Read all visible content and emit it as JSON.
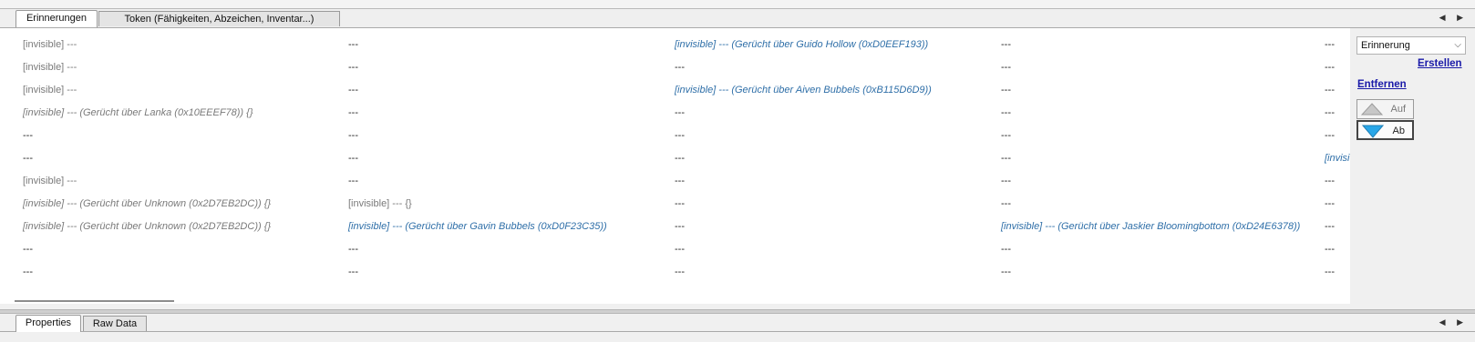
{
  "top_tabs": [
    {
      "label": "Erinnerungen",
      "active": true
    },
    {
      "label": "Token (Fähigkeiten, Abzeichen, Inventar...)",
      "active": false
    }
  ],
  "bottom_tabs": [
    {
      "label": "Properties",
      "active": true
    },
    {
      "label": "Raw Data",
      "active": false
    }
  ],
  "tab_nav_arrows": "◀ ▶",
  "rows": [
    [
      "[invisible] ---",
      "---",
      "[invisible] --- (Gerücht über Guido Hollow (0xD0EEF193))",
      "---",
      "---"
    ],
    [
      "[invisible] ---",
      "---",
      "---",
      "---",
      "---"
    ],
    [
      "[invisible] ---",
      "---",
      "[invisible] --- (Gerücht über Aiven Bubbels (0xB115D6D9))",
      "---",
      "---"
    ],
    [
      "[invisible] --- (Gerücht über Lanka  (0x10EEEF78)) {}",
      "---",
      "---",
      "---",
      "---"
    ],
    [
      "---",
      "---",
      "---",
      "---",
      "---"
    ],
    [
      "---",
      "---",
      "---",
      "---",
      "[invisi"
    ],
    [
      "[invisible] ---",
      "---",
      "---",
      "---",
      "---"
    ],
    [
      "[invisible] --- (Gerücht über Unknown (0x2D7EB2DC)) {}",
      "[invisible] --- {}",
      "---",
      "---",
      "---"
    ],
    [
      "[invisible] --- (Gerücht über Unknown (0x2D7EB2DC)) {}",
      "[invisible] --- (Gerücht über Gavin Bubbels (0xD0F23C35))",
      "---",
      "[invisible] --- (Gerücht über Jaskier Bloomingbottom (0xD24E6378))",
      "---"
    ],
    [
      "---",
      "---",
      "---",
      "---",
      "---"
    ],
    [
      "---",
      "---",
      "---",
      "---",
      "---"
    ]
  ],
  "cell_styles": [
    [
      "grey",
      "plain",
      "link",
      "plain",
      "plain"
    ],
    [
      "grey",
      "plain",
      "plain",
      "plain",
      "plain"
    ],
    [
      "grey",
      "plain",
      "link",
      "plain",
      "plain"
    ],
    [
      "grey-italic",
      "plain",
      "plain",
      "plain",
      "plain"
    ],
    [
      "plain",
      "plain",
      "plain",
      "plain",
      "plain"
    ],
    [
      "plain",
      "plain",
      "plain",
      "plain",
      "link"
    ],
    [
      "grey",
      "plain",
      "plain",
      "plain",
      "plain"
    ],
    [
      "grey-italic",
      "grey",
      "plain",
      "plain",
      "plain"
    ],
    [
      "grey-italic",
      "link",
      "plain",
      "link",
      "plain"
    ],
    [
      "plain",
      "plain",
      "plain",
      "plain",
      "plain"
    ],
    [
      "plain",
      "plain",
      "plain",
      "plain",
      "plain"
    ]
  ],
  "side_panel": {
    "type_select": {
      "value": "Erinnerung"
    },
    "create_label": "Erstellen",
    "remove_label": "Entfernen",
    "up_label": "Auf",
    "down_label": "Ab"
  },
  "colors": {
    "link": "#2f6fa8",
    "grey_text": "#7a7a7a",
    "action_link": "#1a1aa8",
    "down_arrow": "#2aa7e8"
  }
}
